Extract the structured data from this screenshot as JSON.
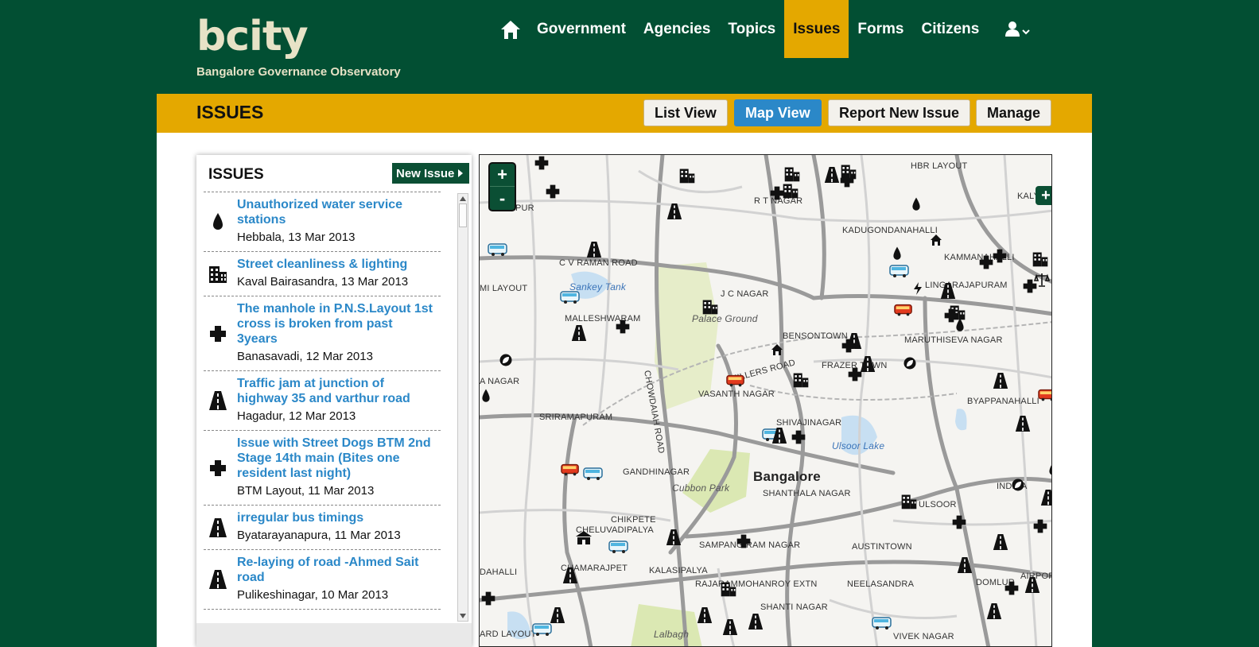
{
  "site": {
    "title": "bcity",
    "subtitle": "Bangalore Governance Observatory"
  },
  "nav": {
    "items": [
      "Government",
      "Agencies",
      "Topics",
      "Issues",
      "Forms",
      "Citizens"
    ],
    "active": "Issues"
  },
  "page": {
    "title": "ISSUES",
    "buttons": {
      "list_view": "List View",
      "map_view": "Map View",
      "report": "Report New Issue",
      "manage": "Manage"
    }
  },
  "panel": {
    "title": "ISSUES",
    "new_issue": "New Issue"
  },
  "issues": [
    {
      "title": "Unauthorized water service stations",
      "meta": "Hebbala, 13 Mar 2013",
      "icon": "water-drop-icon"
    },
    {
      "title": "Street cleanliness & lighting",
      "meta": "Kaval Bairasandra, 13 Mar 2013",
      "icon": "building-icon"
    },
    {
      "title": "The manhole in P.N.S.Layout 1st cross is broken from past 3years",
      "meta": "Banasavadi, 12 Mar 2013",
      "icon": "health-cross-icon"
    },
    {
      "title": "Traffic jam at junction of highway 35 and varthur road",
      "meta": "Hagadur, 12 Mar 2013",
      "icon": "road-icon"
    },
    {
      "title": "Issue with Street Dogs BTM 2nd Stage 14th main (Bites one resident last night)",
      "meta": "BTM Layout, 11 Mar 2013",
      "icon": "health-cross-icon"
    },
    {
      "title": "irregular bus timings",
      "meta": "Byatarayanapura, 11 Mar 2013",
      "icon": "road-icon"
    },
    {
      "title": "Re-laying of road -Ahmed Sait road",
      "meta": "Pulikeshinagar, 10 Mar 2013",
      "icon": "road-icon"
    }
  ],
  "map": {
    "zoom_in": "+",
    "zoom_out": "-",
    "layers": "+",
    "labels": [
      "HBR LAYOUT",
      "KALYA",
      "R T NAGAR",
      "KADUGONDANAHALLI",
      "PUR",
      "C V RAMAN ROAD",
      "KAMMANAHALLI",
      "Sankey Tank",
      "LINGARAJAPURAM",
      "MI LAYOUT",
      "J C NAGAR",
      "MALLESHWARAM",
      "Palace Ground",
      "BENSONTOWN",
      "MARUTHISEVA NAGAR",
      "CHOWDAIAH ROAD",
      "FRAZER TOWN",
      "MILLERS ROAD",
      "A NAGAR",
      "VASANTH NAGAR",
      "BYAPPANAHALLI",
      "SRIRAMAPURAM",
      "SHIVAJINAGAR",
      "Ulsoor Lake",
      "GANDHINAGAR",
      "Bangalore",
      "Cubbon Park",
      "SHANTHALA NAGAR",
      "INDIRA",
      "ULSOOR",
      "CHIKPETE",
      "CHELUVADIPALYA",
      "SAMPANGIRAM NAGAR",
      "AUSTINTOWN",
      "CHAMARAJPET",
      "KALASIPALYA",
      "DAHALLI",
      "RAJARAMMOHANROY EXTN",
      "NEELASANDRA",
      "DOMLUR",
      "AIRPORT",
      "SHANTI NAGAR",
      "ARD LAYOUT",
      "Lalbagh",
      "VIVEK NAGAR"
    ]
  },
  "colors": {
    "header_bg": "#024f33",
    "accent": "#e4a800",
    "link": "#2b88c8",
    "dark_green": "#0b4f34"
  }
}
